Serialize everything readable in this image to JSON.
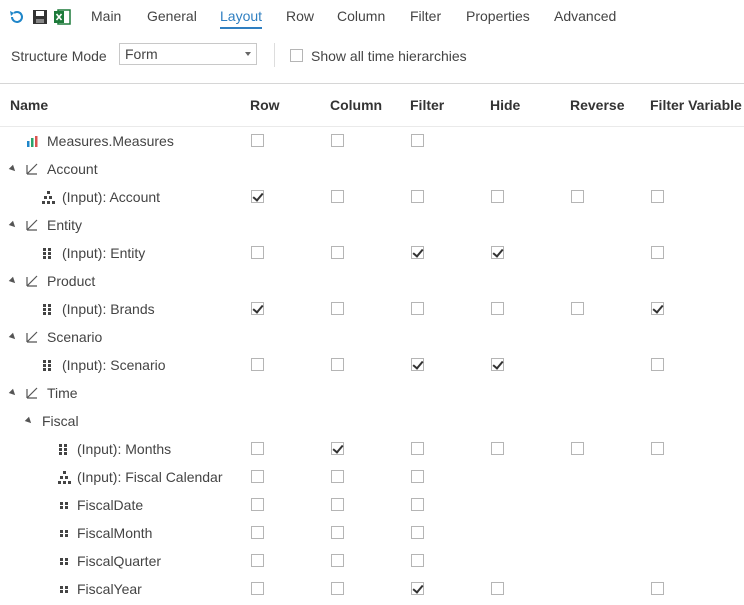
{
  "toolbar": {
    "icons": [
      "refresh-icon",
      "save-icon",
      "excel-icon"
    ],
    "menu": [
      "Main",
      "General",
      "Layout",
      "Row",
      "Column",
      "Filter",
      "Properties",
      "Advanced"
    ],
    "active": "Layout"
  },
  "options": {
    "structure_mode_label": "Structure Mode",
    "structure_mode_value": "Form",
    "show_time_label": "Show all time hierarchies"
  },
  "grid": {
    "headers": [
      "Name",
      "Row",
      "Column",
      "Filter",
      "Hide",
      "Reverse",
      "Filter Variable"
    ],
    "rows": [
      {
        "label": "Measures.Measures",
        "icon": "bar-chart-icon",
        "expand": false,
        "cbs": [
          0,
          0,
          0,
          null,
          null,
          null
        ]
      },
      {
        "label": "Account",
        "icon": "dimension-icon",
        "expand": true,
        "cbs": null
      },
      {
        "label": "(Input): Account",
        "icon": "hierarchy-icon",
        "expand": false,
        "cbs": [
          1,
          0,
          0,
          0,
          0,
          0
        ]
      },
      {
        "label": "Entity",
        "icon": "dimension-icon",
        "expand": true,
        "cbs": null
      },
      {
        "label": "(Input): Entity",
        "icon": "grid-icon",
        "expand": false,
        "cbs": [
          0,
          0,
          1,
          1,
          null,
          0
        ]
      },
      {
        "label": "Product",
        "icon": "dimension-icon",
        "expand": true,
        "cbs": null
      },
      {
        "label": "(Input): Brands",
        "icon": "grid-icon",
        "expand": false,
        "cbs": [
          1,
          0,
          0,
          0,
          0,
          1
        ]
      },
      {
        "label": "Scenario",
        "icon": "dimension-icon",
        "expand": true,
        "cbs": null
      },
      {
        "label": "(Input): Scenario",
        "icon": "grid-icon",
        "expand": false,
        "cbs": [
          0,
          0,
          1,
          1,
          null,
          0
        ]
      },
      {
        "label": "Time",
        "icon": "dimension-icon",
        "expand": true,
        "cbs": null
      },
      {
        "label": "Fiscal",
        "icon": "",
        "expand": true,
        "cbs": null
      },
      {
        "label": "(Input): Months",
        "icon": "grid-icon",
        "expand": false,
        "cbs": [
          0,
          1,
          0,
          0,
          0,
          0
        ]
      },
      {
        "label": "(Input): Fiscal Calendar",
        "icon": "hierarchy-icon",
        "expand": false,
        "cbs": [
          0,
          0,
          0,
          null,
          null,
          null
        ]
      },
      {
        "label": "FiscalDate",
        "icon": "level-icon",
        "expand": false,
        "cbs": [
          0,
          0,
          0,
          null,
          null,
          null
        ]
      },
      {
        "label": "FiscalMonth",
        "icon": "level-icon",
        "expand": false,
        "cbs": [
          0,
          0,
          0,
          null,
          null,
          null
        ]
      },
      {
        "label": "FiscalQuarter",
        "icon": "level-icon",
        "expand": false,
        "cbs": [
          0,
          0,
          0,
          null,
          null,
          null
        ]
      },
      {
        "label": "FiscalYear",
        "icon": "level-icon",
        "expand": false,
        "cbs": [
          0,
          0,
          1,
          0,
          null,
          0
        ]
      }
    ]
  }
}
